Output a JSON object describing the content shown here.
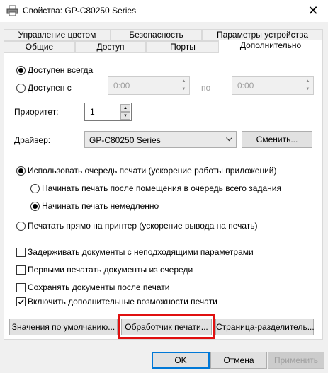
{
  "window": {
    "title": "Свойства: GP-C80250 Series",
    "close_glyph": "✕"
  },
  "tabs_row1": [
    {
      "label": "Управление цветом"
    },
    {
      "label": "Безопасность"
    },
    {
      "label": "Параметры устройства"
    }
  ],
  "tabs_row2": [
    {
      "label": "Общие"
    },
    {
      "label": "Доступ"
    },
    {
      "label": "Порты"
    },
    {
      "label": "Дополнительно",
      "active": true
    }
  ],
  "availability": {
    "always_label": "Доступен всегда",
    "from_label": "Доступен с",
    "from_value": "0:00",
    "to_label": "по",
    "to_value": "0:00",
    "selected": "always"
  },
  "priority": {
    "label": "Приоритет:",
    "value": "1"
  },
  "driver": {
    "label": "Драйвер:",
    "value": "GP-C80250 Series",
    "change_button": "Сменить..."
  },
  "spooling": {
    "use_spool_label": "Использовать очередь печати (ускорение работы приложений)",
    "start_after_last_label": "Начинать печать после помещения в очередь всего задания",
    "start_immediately_label": "Начинать печать немедленно",
    "print_direct_label": "Печатать прямо на принтер (ускорение вывода на печать)",
    "selected_mode": "spool",
    "selected_start": "immediately"
  },
  "options": [
    {
      "label": "Задерживать документы с неподходящими параметрами",
      "checked": false
    },
    {
      "label": "Первыми печатать документы из очереди",
      "checked": false
    },
    {
      "label": "Сохранять документы после печати",
      "checked": false
    },
    {
      "label": "Включить дополнительные возможности печати",
      "checked": true
    }
  ],
  "bottom_buttons": {
    "defaults": "Значения по умолчанию...",
    "processor": "Обработчик печати...",
    "separator": "Страница-разделитель..."
  },
  "dialog_buttons": {
    "ok": "OK",
    "cancel": "Отмена",
    "apply": "Применить"
  },
  "colors": {
    "highlight": "#e01010",
    "focus_blue": "#0078d7"
  }
}
